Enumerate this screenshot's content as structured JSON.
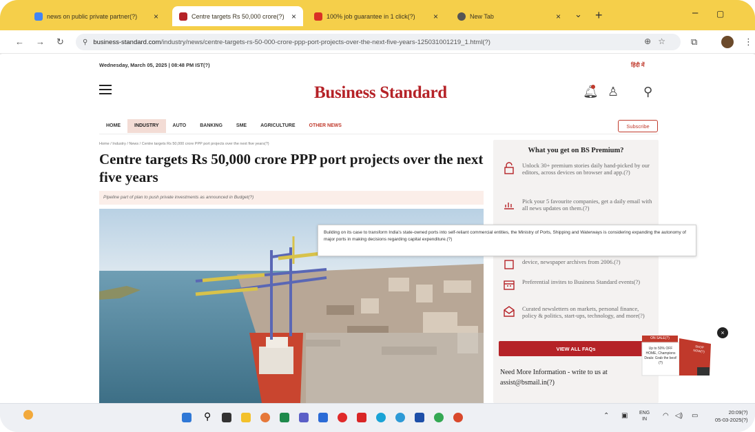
{
  "tabs": [
    {
      "title": "news on public private partner(?)"
    },
    {
      "title": "Centre targets Rs 50,000 crore(?)"
    },
    {
      "title": "100% job guarantee in 1 click(?)"
    },
    {
      "title": "New Tab"
    }
  ],
  "address": {
    "host": "business-standard.com",
    "path": "/industry/news/centre-targets-rs-50-000-crore-ppp-port-projects-over-the-next-five-years-125031001219_1.html(?)"
  },
  "page": {
    "dateline": "Wednesday, March 05, 2025 | 08:48 PM IST(?)",
    "hindi_link": "हिंदी में",
    "brand": "Business Standard",
    "nav": [
      "HOME",
      "INDUSTRY",
      "AUTO",
      "BANKING",
      "SME",
      "AGRICULTURE",
      "OTHER NEWS"
    ],
    "subscribe": "Subscribe",
    "breadcrumb": "Home / Industry / News / Centre targets Rs 50,000 crore PPP port projects over the next five years(?)",
    "headline": "Centre targets Rs 50,000 crore PPP port projects over the next five years",
    "summary": "Pipeline part of plan to push private investments as announced in Budget(?)"
  },
  "tooltip": "Building on its case to transform India's state-owned ports into self-reliant commercial entities, the Ministry of Ports, Shipping and Waterways is considering expanding the autonomy of major ports in making decisions regarding capital expenditure.(?)",
  "sidebar": {
    "title": "What you get on BS Premium?",
    "features": [
      "Unlock 30+ premium stories daily hand-picked by our editors, across devices on browser and app.(?)",
      "Pick your 5 favourite companies, get a daily email with all news updates on them.(?)",
      "device, newspaper archives from 2006.(?)",
      "Preferential invites to Business Standard events(?)",
      "Curated newsletters on markets, personal finance, policy & politics, start-ups, technology, and more(?)"
    ],
    "view_all": "VIEW ALL FAQs",
    "need_more": "Need More Information - write to us at assist@bsmail.in(?)"
  },
  "ad": {
    "top": "ON SALE(?)",
    "text": "Up to 50% OFF HOME, Champions Deals: Grab the best!(?)",
    "side": "SHOP NOW(?)"
  },
  "taskbar": {
    "lang": "ENG",
    "region": "IN",
    "time": "20:09(?)",
    "date": "05-03-2025(?)"
  }
}
